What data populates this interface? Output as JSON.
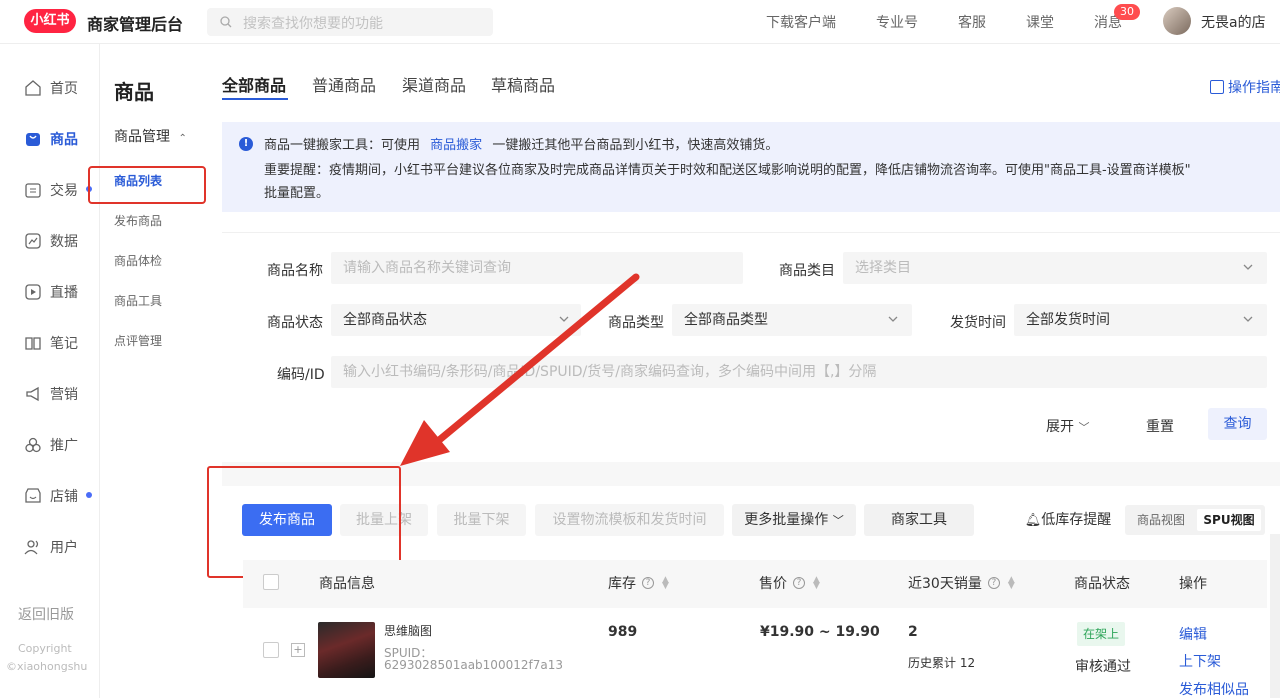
{
  "topbar": {
    "logo": "小红书",
    "brand": "商家管理后台",
    "search_placeholder": "搜索查找你想要的功能",
    "links": [
      "下载客户端",
      "专业号",
      "客服",
      "课堂",
      "消息"
    ],
    "message_badge": "30",
    "user_name": "无畏a的店"
  },
  "leftnav": {
    "items": [
      {
        "label": "首页",
        "icon": "home-icon"
      },
      {
        "label": "商品",
        "icon": "product-icon"
      },
      {
        "label": "交易",
        "icon": "trade-icon"
      },
      {
        "label": "数据",
        "icon": "data-icon"
      },
      {
        "label": "直播",
        "icon": "live-icon"
      },
      {
        "label": "笔记",
        "icon": "note-icon"
      },
      {
        "label": "营销",
        "icon": "marketing-icon"
      },
      {
        "label": "推广",
        "icon": "promotion-icon"
      },
      {
        "label": "店铺",
        "icon": "shop-icon"
      },
      {
        "label": "用户",
        "icon": "user-icon"
      }
    ],
    "back_old": "返回旧版",
    "copyright": "Copyright",
    "copyright_owner": "©xiaohongshu"
  },
  "subnav": {
    "title": "商品",
    "group": "商品管理",
    "items": [
      "商品列表",
      "发布商品",
      "商品体检",
      "商品工具",
      "点评管理"
    ]
  },
  "tabs": [
    "全部商品",
    "普通商品",
    "渠道商品",
    "草稿商品"
  ],
  "guide": "操作指南",
  "notice": {
    "line1_a": "商品一键搬家工具：可使用",
    "line1_link": "商品搬家",
    "line1_b": "一键搬迁其他平台商品到小红书，快速高效铺货。",
    "line2": "重要提醒：疫情期间，小红书平台建议各位商家及时完成商品详情页关于时效和配送区域影响说明的配置，降低店铺物流咨询率。可使用\"商品工具-设置商详模板\"",
    "line3": "批量配置。"
  },
  "filters": {
    "name_label": "商品名称",
    "name_placeholder": "请输入商品名称关键词查询",
    "category_label": "商品类目",
    "category_placeholder": "选择类目",
    "status_label": "商品状态",
    "status_value": "全部商品状态",
    "type_label": "商品类型",
    "type_value": "全部商品类型",
    "ship_label": "发货时间",
    "ship_value": "全部发货时间",
    "code_label": "编码/ID",
    "code_placeholder": "输入小红书编码/条形码/商品ID/SPUID/货号/商家编码查询，多个编码中间用【,】分隔",
    "expand": "展开",
    "reset": "重置",
    "query": "查询"
  },
  "actions": {
    "publish": "发布商品",
    "batch_on": "批量上架",
    "batch_off": "批量下架",
    "logistics": "设置物流模板和发货时间",
    "more": "更多批量操作",
    "tools": "商家工具",
    "low_stock": "低库存提醒",
    "view_product": "商品视图",
    "view_spu": "SPU视图"
  },
  "table": {
    "headers": [
      "商品信息",
      "库存",
      "售价",
      "近30天销量",
      "商品状态",
      "操作"
    ],
    "rows": [
      {
        "name": "思维脑图",
        "spuid_label": "SPUID：",
        "spuid": "6293028501aab100012f7a13",
        "stock": "989",
        "price": "¥19.90 ~ 19.90",
        "sales": "2",
        "sales_total": "历史累计 12",
        "status": "在架上",
        "audit": "审核通过",
        "ops": [
          "编辑",
          "上下架",
          "发布相似品"
        ]
      }
    ]
  },
  "colors": {
    "brand_red": "#ff2442",
    "primary_blue": "#3b6df2",
    "annotation_red": "#e0342a"
  }
}
